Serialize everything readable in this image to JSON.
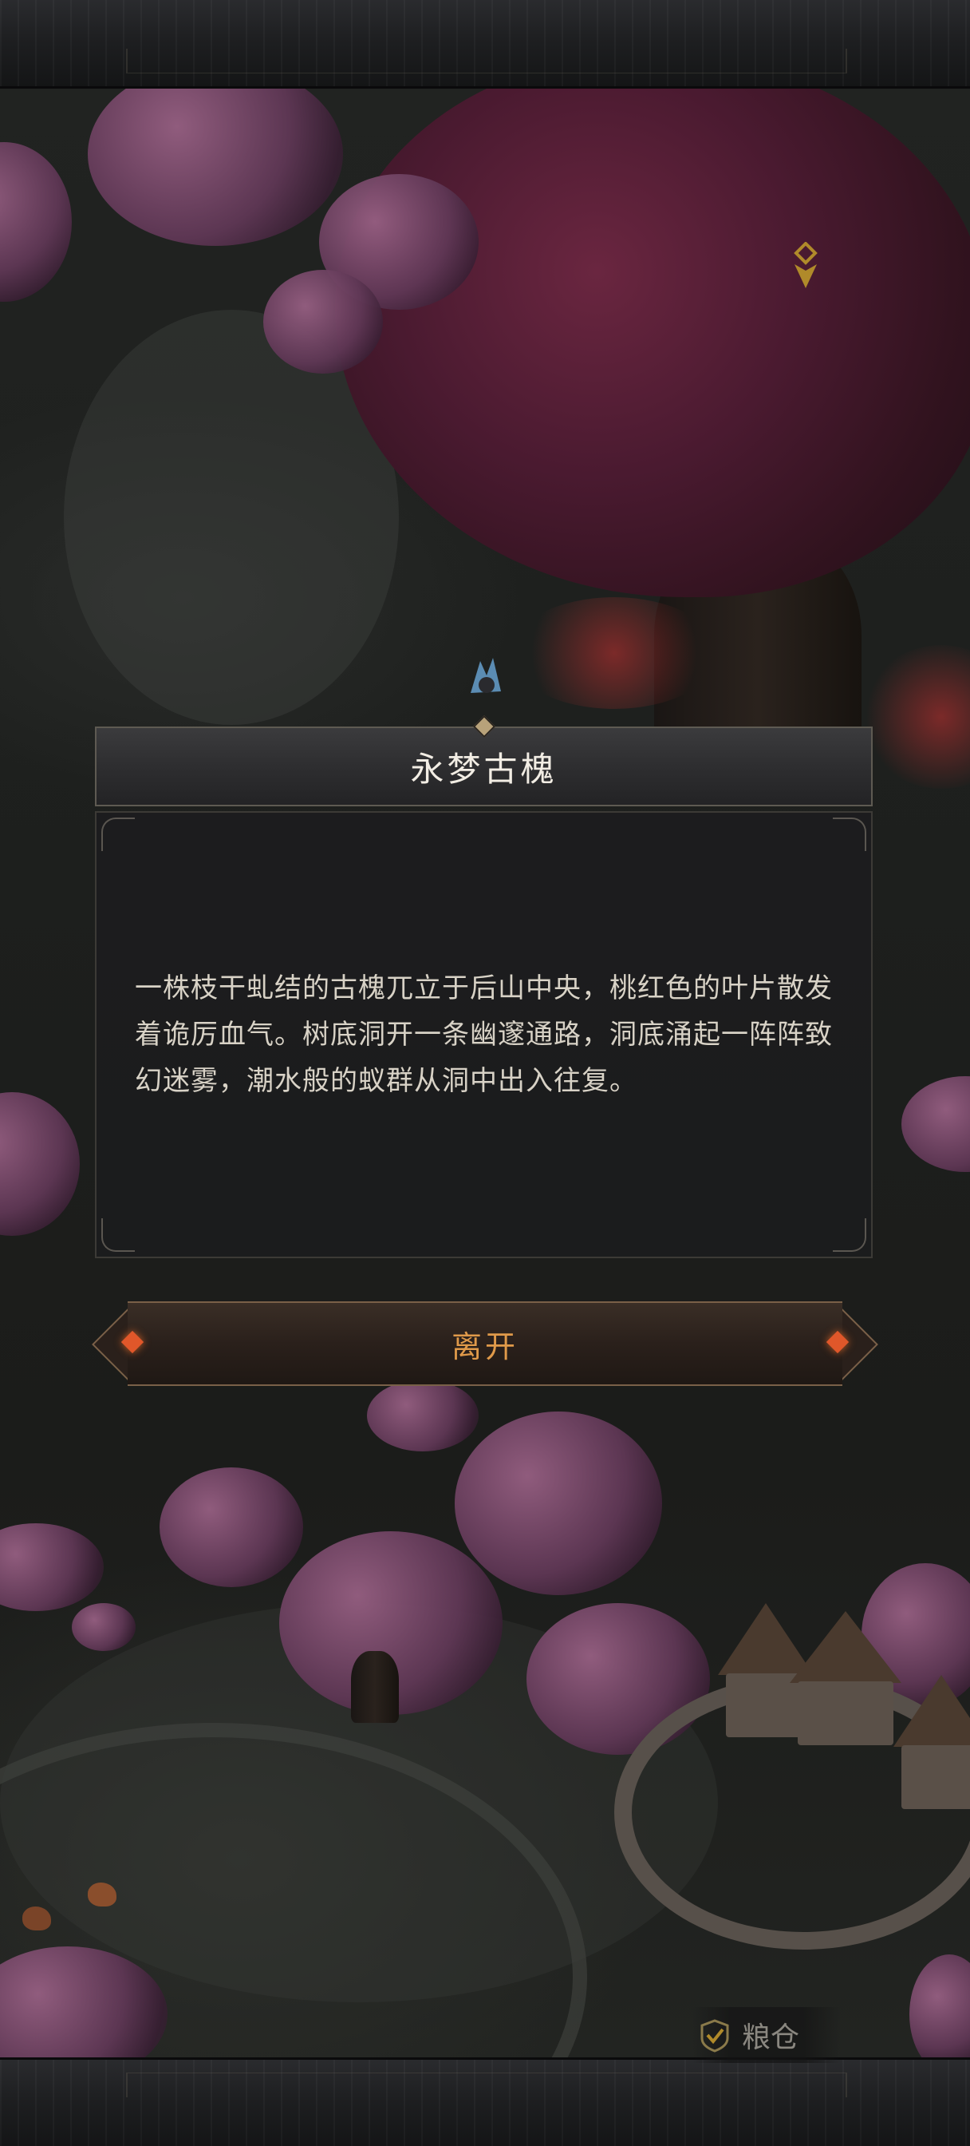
{
  "dialog": {
    "title": "永梦古槐",
    "description": "一株枝干虬结的古槐兀立于后山中央，桃红色的叶片散发着诡厉血气。树底洞开一条幽邃通路，洞底涌起一阵阵致幻迷雾，潮水般的蚁群从洞中出入往复。"
  },
  "actions": {
    "leave_label": "离开"
  },
  "map": {
    "location_label": "粮仓",
    "location_icon": "check-shield-icon",
    "marker_icon": "map-marker-icon"
  },
  "colors": {
    "accent": "#e09a4a",
    "title_text": "#f2ede4",
    "body_text": "#d8d2c6",
    "great_tree": "#4a1a30",
    "blossom": "#7a4a70"
  }
}
